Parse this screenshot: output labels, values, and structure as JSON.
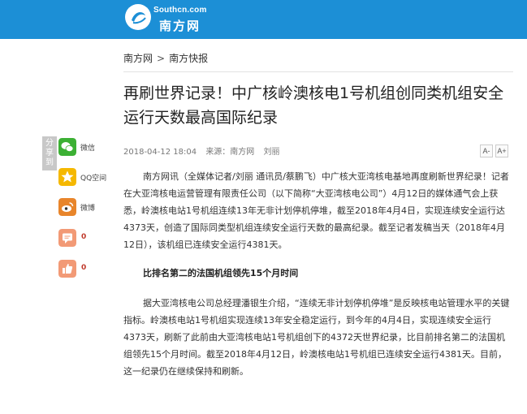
{
  "header": {
    "logo_en": "Southcn.com",
    "logo_cn": "南方网",
    "bg_color": "#1c8fd6"
  },
  "breadcrumb": {
    "items": [
      "南方网",
      "南方快报"
    ],
    "separator": ">"
  },
  "article": {
    "title": "再刷世界记录！中广核岭澳核电1号机组创同类机组安全运行天数最高国际纪录",
    "meta": {
      "datetime": "2018-04-12 18:04",
      "source": "来源：南方网",
      "author": "刘丽"
    },
    "font_buttons": [
      "A-",
      "A+"
    ],
    "paragraphs": [
      "南方网讯（全媒体记者/刘丽 通讯员/蔡鹏飞）中广核大亚湾核电基地再度刷新世界纪录！记者在大亚湾核电运营管理有限责任公司（以下简称“大亚湾核电公司”）4月12日的媒体通气会上获悉，岭澳核电站1号机组连续13年无非计划停机停堆，截至2018年4月4日，实现连续安全运行达4373天，创造了国际同类型机组连续安全运行天数的最高纪录。截至记者发稿当天（2018年4月12日），该机组已连续安全运行4381天。"
    ],
    "subheading": "比排名第二的法国机组领先15个月时间",
    "paragraphs2": [
      "据大亚湾核电公司总经理潘银生介绍，“连续无非计划停机停堆”是反映核电站管理水平的关键指标。岭澳核电站1号机组实现连续13年安全稳定运行，到今年的4月4日，实现连续安全运行4373天，刷新了此前由大亚湾核电站1号机组创下的4372天世界纪录，比目前排名第二的法国机组领先15个月时间。截至2018年4月12日，岭澳核电站1号机组已连续安全运行4381天。目前，这一纪录仍在继续保持和刷新。"
    ]
  },
  "share": {
    "tag": "分享到",
    "items": [
      {
        "label": "微信",
        "icon": "wechat-icon",
        "color": "#3cb034"
      },
      {
        "label": "QQ空间",
        "icon": "qzone-icon",
        "color": "#f5b800"
      },
      {
        "label": "微博",
        "icon": "weibo-icon",
        "color": "#e8852b"
      },
      {
        "label": "0",
        "icon": "comment-icon",
        "color": "#f29a76"
      },
      {
        "label": "0",
        "icon": "thumbs-up-icon",
        "color": "#f29a76"
      }
    ]
  }
}
